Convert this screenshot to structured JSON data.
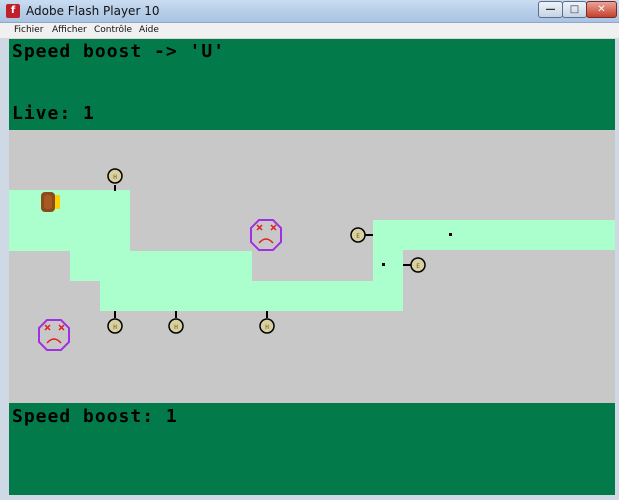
{
  "window": {
    "title": "Adobe Flash Player 10",
    "app_icon_glyph": "f",
    "minimize_glyph": "—",
    "maximize_glyph": "□",
    "close_glyph": "✕"
  },
  "menu": [
    "Fichier",
    "Afficher",
    "Contrôle",
    "Aide"
  ],
  "hud": {
    "hint": "Speed boost -> 'U'",
    "lives_label": "Live:",
    "lives_value": "1",
    "speed_boost_label": "Speed boost:",
    "speed_boost_value": "1"
  },
  "colors": {
    "hud_green": "#037a4a",
    "arena_gray": "#c8c8c8",
    "path_mint": "#aaffcc",
    "enemy_outline": "#a030e0",
    "enemy_mark": "#e02020",
    "player": "#8b4a1c",
    "player_flame": "#ffd000"
  },
  "sprites": {
    "player": "orange-brown player ship",
    "enemies": [
      "sad-face-enemy-icon",
      "sad-face-enemy-icon"
    ],
    "turrets": [
      "turret-icon",
      "turret-icon",
      "turret-icon",
      "turret-icon",
      "turret-icon",
      "turret-icon"
    ],
    "pickups": [
      "dot-pickup",
      "dot-pickup"
    ]
  }
}
